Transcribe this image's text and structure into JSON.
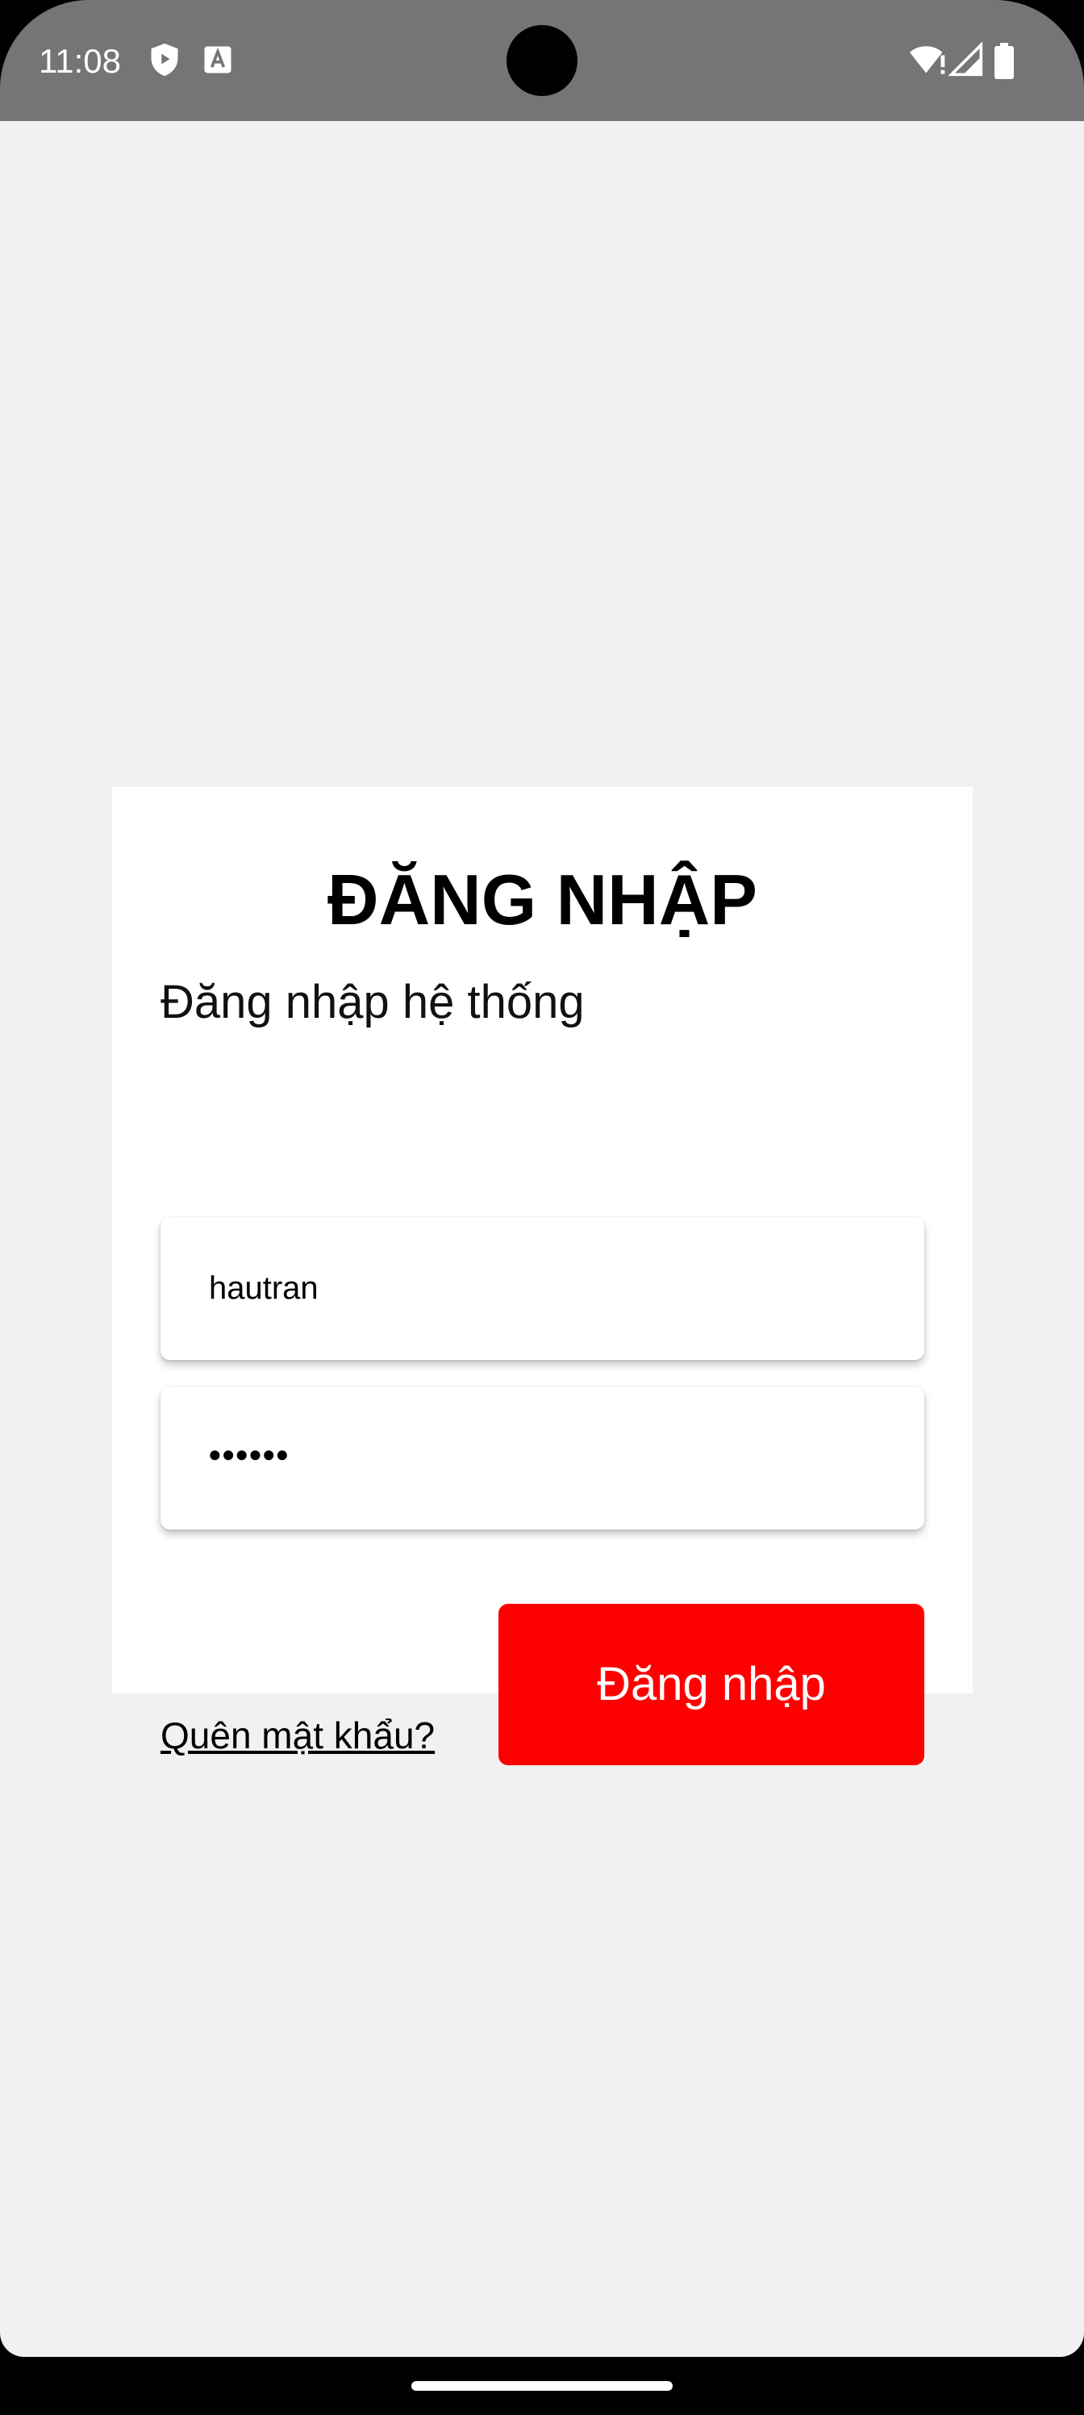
{
  "status_bar": {
    "time": "11:08",
    "left_icons": [
      "play-protect-icon",
      "text-a-icon"
    ],
    "right_icons": [
      "wifi-alert-icon",
      "cell-signal-icon",
      "battery-icon"
    ],
    "background": "#757575"
  },
  "login": {
    "title": "ĐĂNG NHẬP",
    "subtitle": "Đăng nhập hệ thống",
    "username_value": "hautran",
    "password_value": "••••••",
    "forgot_password_label": "Quên mật khẩu?",
    "submit_label": "Đăng nhập",
    "accent_color": "#ff0000"
  },
  "colors": {
    "page_background": "#f1f1f1",
    "card_background": "#ffffff"
  }
}
